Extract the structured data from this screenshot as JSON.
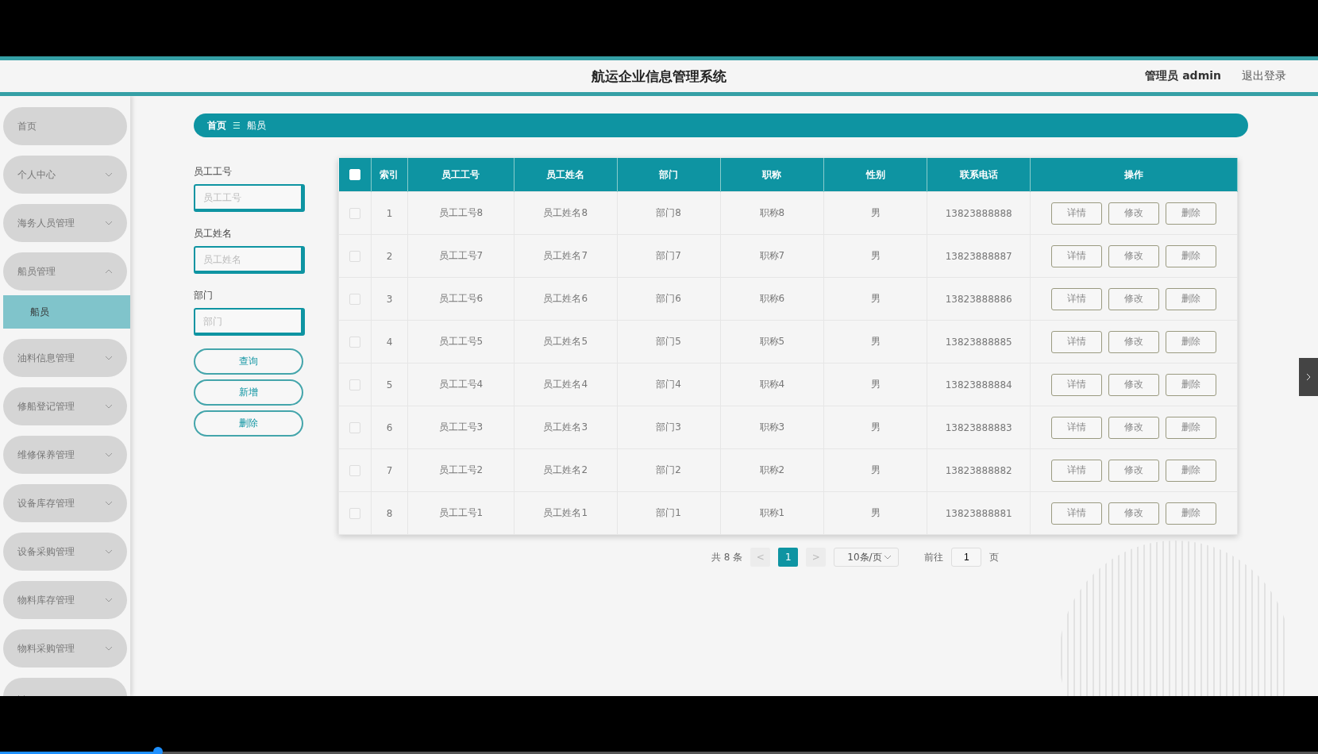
{
  "header": {
    "title": "航运企业信息管理系统",
    "user": "管理员 admin",
    "logout": "退出登录"
  },
  "sidebar": {
    "items": [
      {
        "label": "首页",
        "kind": "plain"
      },
      {
        "label": "个人中心",
        "kind": "menu",
        "expanded": false
      },
      {
        "label": "海务人员管理",
        "kind": "menu",
        "expanded": false
      },
      {
        "label": "船员管理",
        "kind": "menu",
        "expanded": true,
        "children": [
          {
            "label": "船员",
            "selected": true
          }
        ]
      },
      {
        "label": "油料信息管理",
        "kind": "menu",
        "expanded": false
      },
      {
        "label": "修船登记管理",
        "kind": "menu",
        "expanded": false
      },
      {
        "label": "维修保养管理",
        "kind": "menu",
        "expanded": false
      },
      {
        "label": "设备库存管理",
        "kind": "menu",
        "expanded": false
      },
      {
        "label": "设备采购管理",
        "kind": "menu",
        "expanded": false
      },
      {
        "label": "物料库存管理",
        "kind": "menu",
        "expanded": false
      },
      {
        "label": "物料采购管理",
        "kind": "menu",
        "expanded": false
      },
      {
        "kind": "menu",
        "expanded": false
      }
    ]
  },
  "breadcrumb": {
    "home": "首页",
    "separator": "☰",
    "current": "船员"
  },
  "filters": [
    {
      "label": "员工工号",
      "placeholder": "员工工号"
    },
    {
      "label": "员工姓名",
      "placeholder": "员工姓名"
    },
    {
      "label": "部门",
      "placeholder": "部门"
    }
  ],
  "actions": [
    "查询",
    "新增",
    "删除"
  ],
  "table": {
    "select_all": {
      "checked": false
    },
    "columns": [
      "索引",
      "员工工号",
      "员工姓名",
      "部门",
      "职称",
      "性别",
      "联系电话",
      "操作"
    ],
    "rows": [
      {
        "checked": false,
        "cells": [
          "1",
          "员工工号8",
          "员工姓名8",
          "部门8",
          "职称8",
          "男",
          "13823888888"
        ],
        "buttons": [
          "详情",
          "修改",
          "删除"
        ]
      },
      {
        "checked": false,
        "cells": [
          "2",
          "员工工号7",
          "员工姓名7",
          "部门7",
          "职称7",
          "男",
          "13823888887"
        ],
        "buttons": [
          "详情",
          "修改",
          "删除"
        ]
      },
      {
        "checked": false,
        "cells": [
          "3",
          "员工工号6",
          "员工姓名6",
          "部门6",
          "职称6",
          "男",
          "13823888886"
        ],
        "buttons": [
          "详情",
          "修改",
          "删除"
        ]
      },
      {
        "checked": false,
        "cells": [
          "4",
          "员工工号5",
          "员工姓名5",
          "部门5",
          "职称5",
          "男",
          "13823888885"
        ],
        "buttons": [
          "详情",
          "修改",
          "删除"
        ]
      },
      {
        "checked": false,
        "cells": [
          "5",
          "员工工号4",
          "员工姓名4",
          "部门4",
          "职称4",
          "男",
          "13823888884"
        ],
        "buttons": [
          "详情",
          "修改",
          "删除"
        ]
      },
      {
        "checked": false,
        "cells": [
          "6",
          "员工工号3",
          "员工姓名3",
          "部门3",
          "职称3",
          "男",
          "13823888883"
        ],
        "buttons": [
          "详情",
          "修改",
          "删除"
        ]
      },
      {
        "checked": false,
        "cells": [
          "7",
          "员工工号2",
          "员工姓名2",
          "部门2",
          "职称2",
          "男",
          "13823888882"
        ],
        "buttons": [
          "详情",
          "修改",
          "删除"
        ]
      },
      {
        "checked": false,
        "cells": [
          "8",
          "员工工号1",
          "员工姓名1",
          "部门1",
          "职称1",
          "男",
          "13823888881"
        ],
        "buttons": [
          "详情",
          "修改",
          "删除"
        ]
      }
    ]
  },
  "pagination": {
    "total": "共 8 条",
    "prev": "<",
    "pages": [
      {
        "label": "1",
        "selected": true
      }
    ],
    "next": ">",
    "page_size": "10条/页",
    "goto_label": "前往",
    "goto_value": "1",
    "goto_suffix": "页"
  },
  "video_progress": {
    "level": 0.12
  }
}
